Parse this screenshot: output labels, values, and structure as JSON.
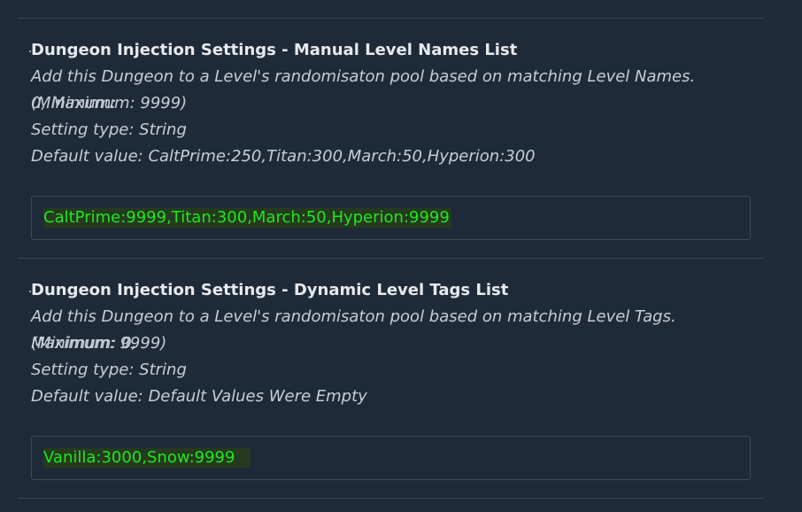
{
  "settings": [
    {
      "title": "Dungeon Injection Settings - Manual Level Names List",
      "desc_line1": "Add this Dungeon to a Level's randomisaton pool based on matching Level Names. (Minimum:",
      "desc_line2": "0, Maximum: 9999)",
      "setting_type": "Setting type: String",
      "default_value": "Default value: CaltPrime:250,Titan:300,March:50,Hyperion:300",
      "input_value": "CaltPrime:9999,Titan:300,March:50,Hyperion:9999"
    },
    {
      "title": "Dungeon Injection Settings - Dynamic Level Tags List",
      "desc_line1": "Add this Dungeon to a Level's randomisaton pool based on matching Level Tags. (Minimum: 0,",
      "desc_line2": "Maximum: 9999)",
      "setting_type": "Setting type: String",
      "default_value": "Default value: Default Values Were Empty",
      "input_value": "Vanilla:3000,Snow:9999"
    }
  ],
  "colors": {
    "background": "#1f2a38",
    "title": "#e6e9ee",
    "description": "#c7cdd6",
    "input_text": "#1ee81e",
    "input_highlight": "#253a1f",
    "border": "#3d4a59"
  }
}
